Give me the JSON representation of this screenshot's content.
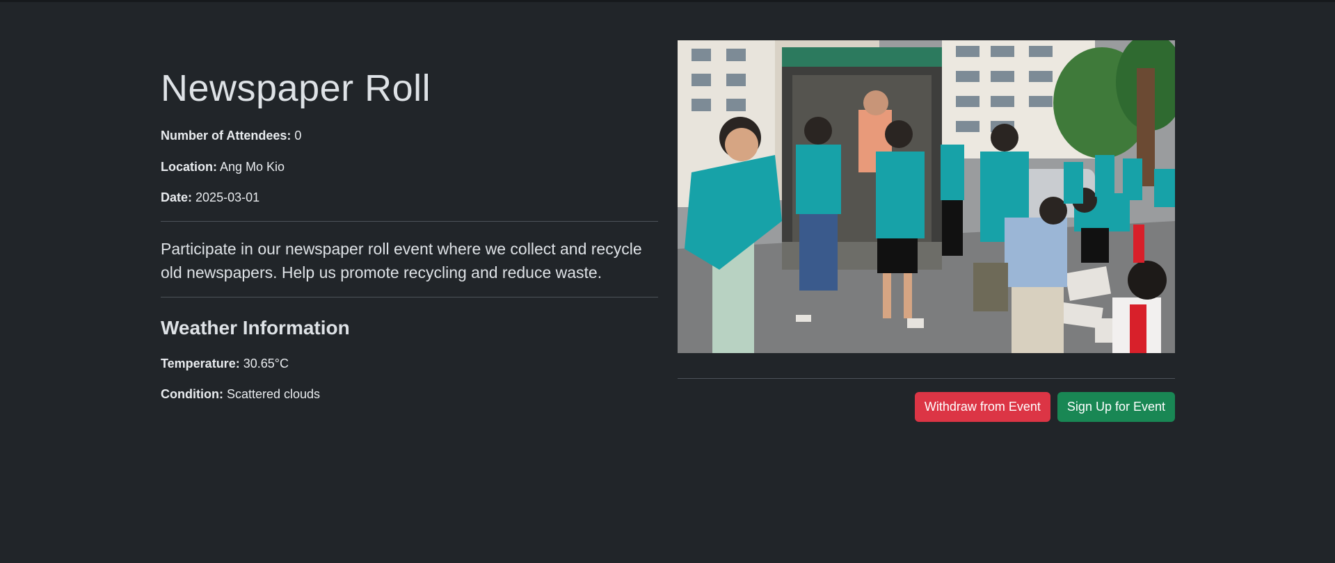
{
  "event": {
    "title": "Newspaper Roll",
    "attendees_label": "Number of Attendees:",
    "attendees_value": "0",
    "location_label": "Location:",
    "location_value": "Ang Mo Kio",
    "date_label": "Date:",
    "date_value": "2025-03-01",
    "description": "Participate in our newspaper roll event where we collect and recycle old newspapers. Help us promote recycling and reduce waste."
  },
  "weather": {
    "heading": "Weather Information",
    "temperature_label": "Temperature:",
    "temperature_value": "30.65°C",
    "condition_label": "Condition:",
    "condition_value": "Scattered clouds"
  },
  "actions": {
    "withdraw_label": "Withdraw from Event",
    "signup_label": "Sign Up for Event"
  },
  "colors": {
    "background": "#212529",
    "danger": "#dc3545",
    "success": "#198754",
    "shirt_teal": "#17a2a8"
  }
}
